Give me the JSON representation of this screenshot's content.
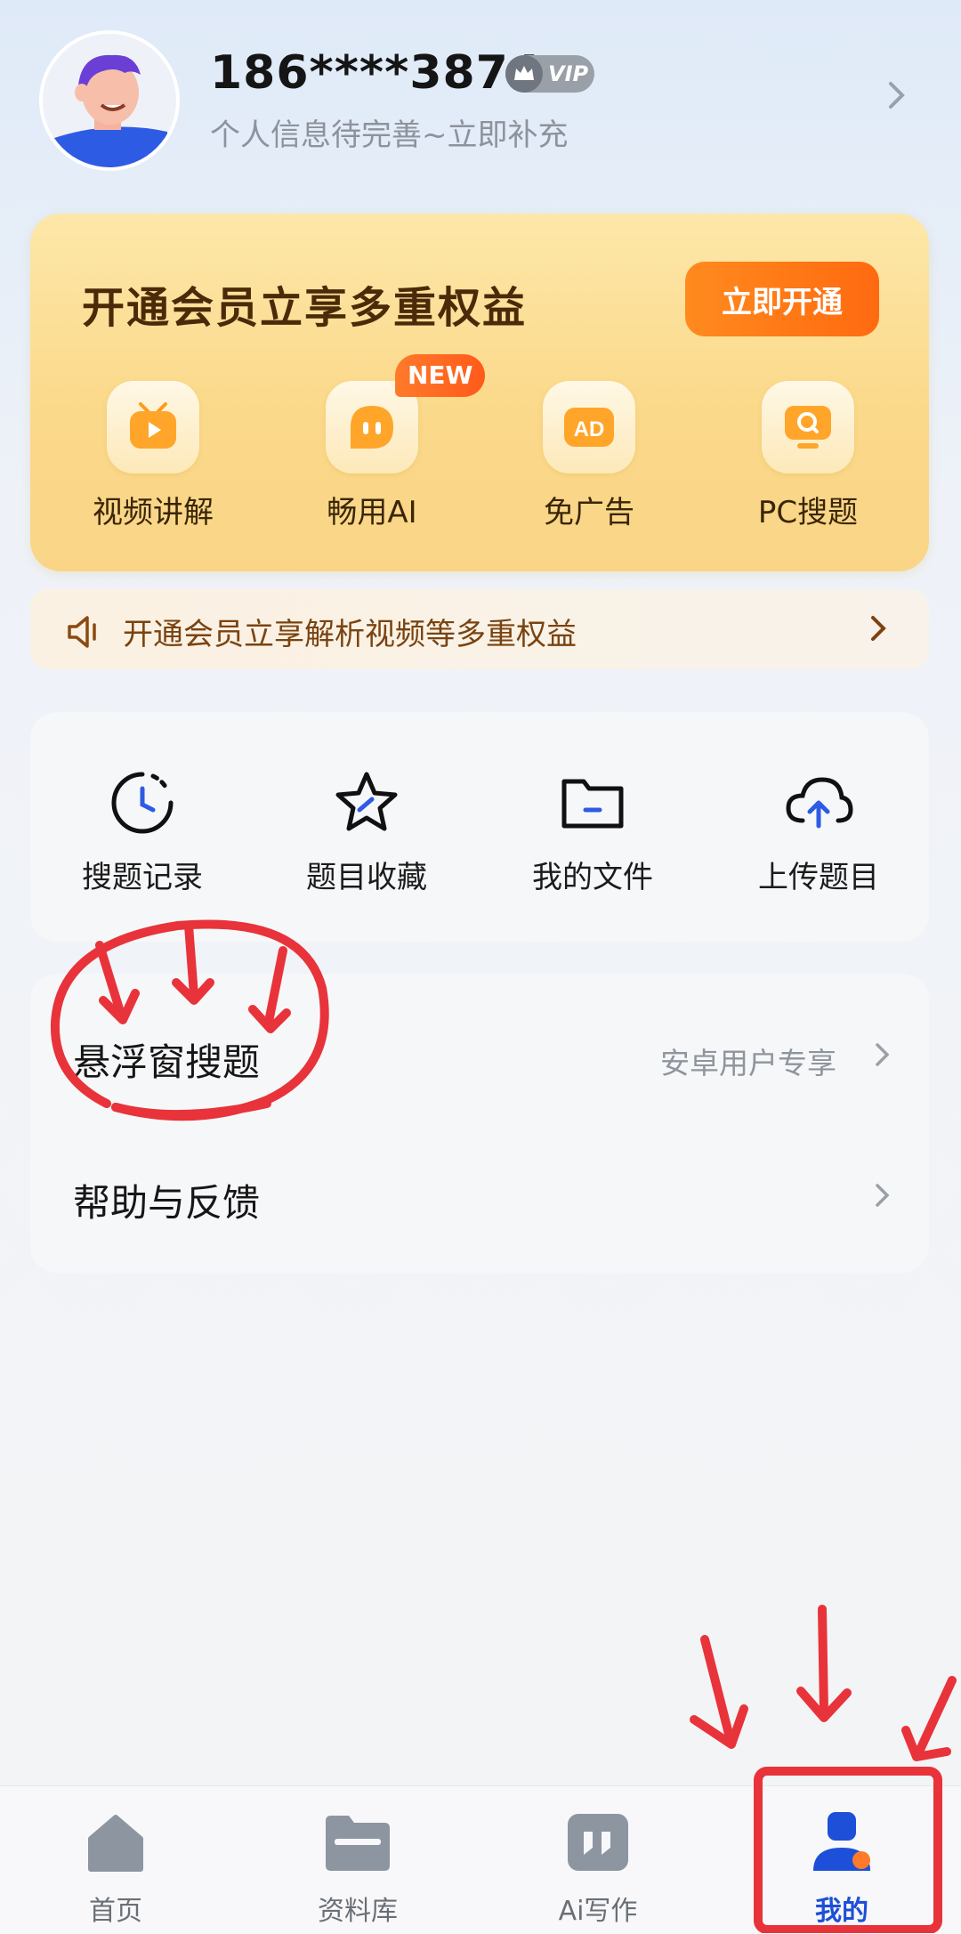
{
  "profile": {
    "phone": "186****3874",
    "vip_badge": "VIP",
    "subtitle": "个人信息待完善~立即补充"
  },
  "vip_card": {
    "title": "开通会员立享多重权益",
    "button": "立即开通",
    "new_badge": "NEW",
    "items": [
      {
        "label": "视频讲解",
        "icon": "video-play-icon"
      },
      {
        "label": "畅用AI",
        "icon": "ai-chat-icon"
      },
      {
        "label": "免广告",
        "icon": "ad-icon",
        "icon_text": "AD"
      },
      {
        "label": "PC搜题",
        "icon": "pc-search-icon"
      }
    ]
  },
  "notice": {
    "text": "开通会员立享解析视频等多重权益"
  },
  "tools": [
    {
      "label": "搜题记录",
      "icon": "clock-history-icon"
    },
    {
      "label": "题目收藏",
      "icon": "star-icon"
    },
    {
      "label": "我的文件",
      "icon": "folder-icon"
    },
    {
      "label": "上传题目",
      "icon": "cloud-upload-icon"
    }
  ],
  "list": [
    {
      "label": "悬浮窗搜题",
      "right": "安卓用户专享"
    },
    {
      "label": "帮助与反馈",
      "right": ""
    }
  ],
  "tabbar": {
    "tabs": [
      {
        "label": "首页",
        "icon": "home-icon",
        "active": false
      },
      {
        "label": "资料库",
        "icon": "folder-library-icon",
        "active": false
      },
      {
        "label": "Ai写作",
        "icon": "ai-writing-icon",
        "active": false
      },
      {
        "label": "我的",
        "icon": "profile-icon",
        "active": true
      }
    ]
  },
  "colors": {
    "accent_orange": "#ff6a10",
    "active_tab": "#1d4fd8",
    "annotation_red": "#e8333a"
  }
}
